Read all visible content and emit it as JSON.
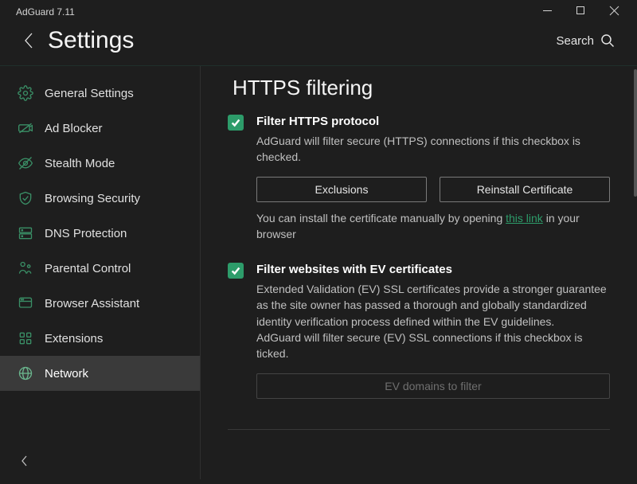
{
  "titlebar": {
    "app": "AdGuard 7.11"
  },
  "header": {
    "title": "Settings",
    "search": "Search"
  },
  "sidebar": {
    "items": [
      {
        "label": "General Settings"
      },
      {
        "label": "Ad Blocker"
      },
      {
        "label": "Stealth Mode"
      },
      {
        "label": "Browsing Security"
      },
      {
        "label": "DNS Protection"
      },
      {
        "label": "Parental Control"
      },
      {
        "label": "Browser Assistant"
      },
      {
        "label": "Extensions"
      },
      {
        "label": "Network"
      }
    ]
  },
  "content": {
    "section_title": "HTTPS filtering",
    "option1": {
      "title": "Filter HTTPS protocol",
      "desc": "AdGuard will filter secure (HTTPS) connections if this checkbox is checked.",
      "btn_exclusions": "Exclusions",
      "btn_reinstall": "Reinstall Certificate",
      "hint_pre": "You can install the certificate manually by opening ",
      "hint_link": "this link",
      "hint_post": " in your browser",
      "checked": true
    },
    "option2": {
      "title": "Filter websites with EV certificates",
      "desc": "Extended Validation (EV) SSL certificates provide a stronger guarantee as the site owner has passed a thorough and globally standardized identity verification process defined within the EV guidelines.\nAdGuard will filter secure (EV) SSL connections if this checkbox is ticked.",
      "btn_ev": "EV domains to filter",
      "checked": true
    }
  }
}
